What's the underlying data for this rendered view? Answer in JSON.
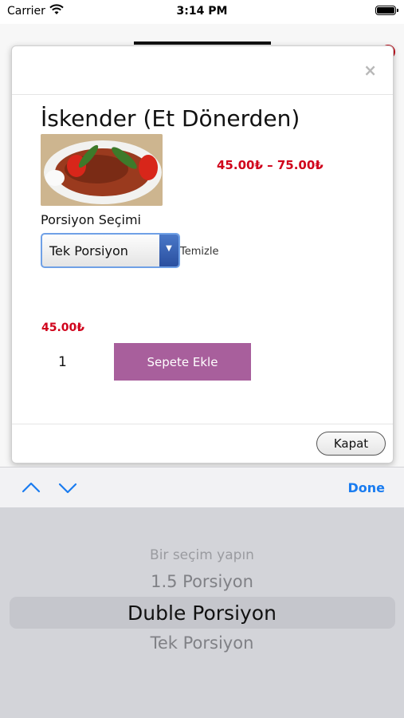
{
  "status_bar": {
    "carrier": "Carrier",
    "time": "3:14 PM"
  },
  "modal": {
    "close_label": "×",
    "title": "İskender (Et Dönerden)",
    "price_range": "45.00₺ – 75.00₺",
    "portion_label": "Porsiyon Seçimi",
    "selected_portion": "Tek Porsiyon",
    "clear_label": "Temizle",
    "price": "45.00₺",
    "quantity": "1",
    "add_to_cart_label": "Sepete Ekle",
    "close_button_label": "Kapat"
  },
  "toolbar": {
    "done_label": "Done"
  },
  "picker": {
    "options": [
      "Bir seçim yapın",
      "1.5 Porsiyon",
      "Duble Porsiyon",
      "Tek Porsiyon"
    ],
    "highlighted": "Duble Porsiyon"
  },
  "colors": {
    "accent_red": "#d0021b",
    "add_button": "#a85f9c",
    "ios_blue": "#1a7cf0"
  }
}
